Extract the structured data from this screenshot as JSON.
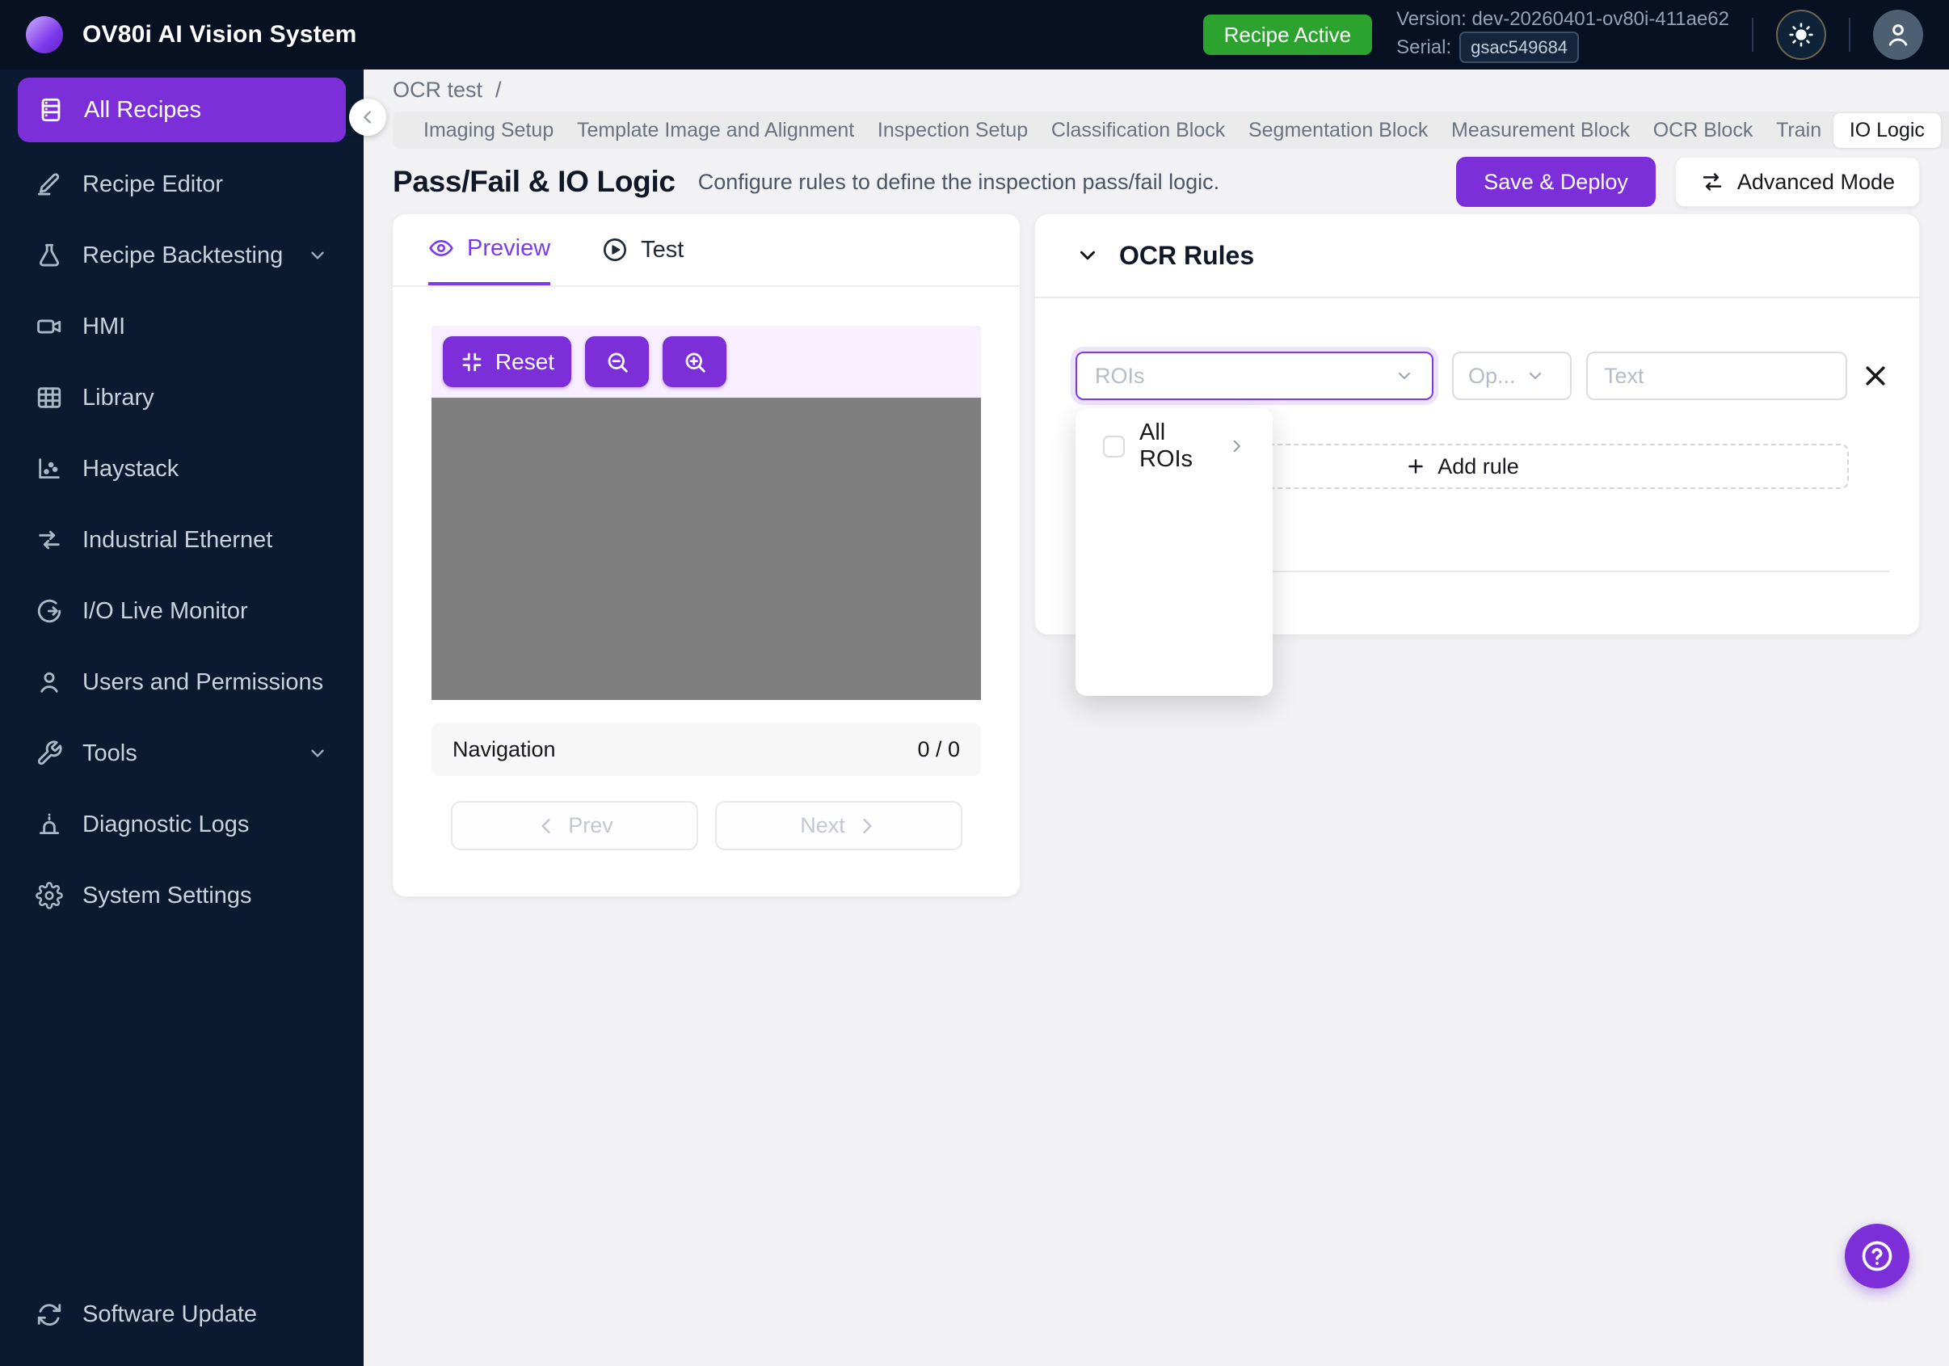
{
  "header": {
    "app_title": "OV80i AI Vision System",
    "recipe_badge": "Recipe Active",
    "version_line": "Version: dev-20260401-ov80i-411ae62",
    "serial_label": "Serial:",
    "serial_value": "gsac549684"
  },
  "sidebar": {
    "items": [
      {
        "label": "All Recipes",
        "icon": "recipes-icon",
        "active": true
      },
      {
        "label": "Recipe Editor",
        "icon": "pencil-icon"
      },
      {
        "label": "Recipe Backtesting",
        "icon": "flask-icon",
        "expandable": true
      },
      {
        "label": "HMI",
        "icon": "video-camera-icon"
      },
      {
        "label": "Library",
        "icon": "grid-icon"
      },
      {
        "label": "Haystack",
        "icon": "scatter-chart-icon"
      },
      {
        "label": "Industrial Ethernet",
        "icon": "swap-arrows-icon"
      },
      {
        "label": "I/O Live Monitor",
        "icon": "circular-arrow-icon"
      },
      {
        "label": "Users and Permissions",
        "icon": "user-icon"
      },
      {
        "label": "Tools",
        "icon": "wrench-icon",
        "expandable": true
      },
      {
        "label": "Diagnostic Logs",
        "icon": "alarm-icon"
      },
      {
        "label": "System Settings",
        "icon": "gear-icon"
      }
    ],
    "footer_item": {
      "label": "Software Update",
      "icon": "sync-icon"
    }
  },
  "breadcrumb": {
    "recipe_name": "OCR test",
    "separator": "/"
  },
  "tab_bar": {
    "tabs": [
      "Imaging Setup",
      "Template Image and Alignment",
      "Inspection Setup",
      "Classification Block",
      "Segmentation Block",
      "Measurement Block",
      "OCR Block",
      "Train",
      "IO Logic"
    ],
    "active_tab": "IO Logic"
  },
  "page_header": {
    "title": "Pass/Fail & IO Logic",
    "subtitle": "Configure rules to define the inspection pass/fail logic.",
    "save_deploy_label": "Save & Deploy",
    "advanced_mode_label": "Advanced Mode"
  },
  "preview_panel": {
    "preview_tab": "Preview",
    "test_tab": "Test",
    "reset_label": "Reset",
    "navigation_label": "Navigation",
    "navigation_counter": "0 / 0",
    "prev_label": "Prev",
    "next_label": "Next"
  },
  "rules_panel": {
    "title": "OCR Rules",
    "rois_placeholder": "ROIs",
    "operator_placeholder": "Op...",
    "text_placeholder": "Text",
    "add_rule_label": "Add rule",
    "dropdown_option": "All ROIs"
  },
  "colors": {
    "accent_purple": "#7c2fd9",
    "focus_purple": "#7c3aed",
    "badge_green": "#2da32f",
    "header_bg": "#071122",
    "sidebar_bg": "#0b1a30",
    "canvas_gray": "#7f7f7f",
    "toolbar_lavender": "#f7eefe"
  }
}
